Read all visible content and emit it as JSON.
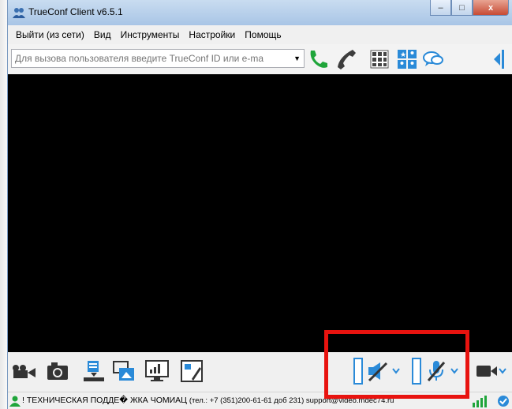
{
  "window": {
    "title": "TrueConf Client v6.5.1",
    "controls": {
      "minimize": "–",
      "maximize": "□",
      "close": "x"
    }
  },
  "menu": [
    "Выйти (из сети)",
    "Вид",
    "Инструменты",
    "Настройки",
    "Помощь"
  ],
  "toolbar": {
    "call_placeholder": "Для вызова пользователя введите TrueConf ID или e-ma",
    "icons": [
      "call-icon",
      "hangup-icon",
      "dialpad-icon",
      "contacts-icon",
      "chat-icon",
      "collapse-panel-icon"
    ]
  },
  "bottom_toolbar": {
    "icons": [
      "video-camera-icon",
      "snapshot-camera-icon",
      "file-transfer-icon",
      "picture-in-picture-icon",
      "screen-share-icon",
      "slideshow-icon",
      "speaker-muted-icon",
      "microphone-muted-icon",
      "camera-toggle-icon"
    ]
  },
  "status": {
    "text_main": "! ТЕХНИЧЕСКАЯ ПОДДЕ� ЖКА ЧОМИАЦ ",
    "text_contact": "(тел.: +7 (351)200-61-61 доб 231) ",
    "text_email": "support@video.mdec74.ru"
  },
  "colors": {
    "video_background": "#000000",
    "highlight_frame": "#e8130f",
    "call_green": "#1fa53a",
    "hangup_gray": "#3c3c3c",
    "accent_blue": "#2a8ad8"
  }
}
